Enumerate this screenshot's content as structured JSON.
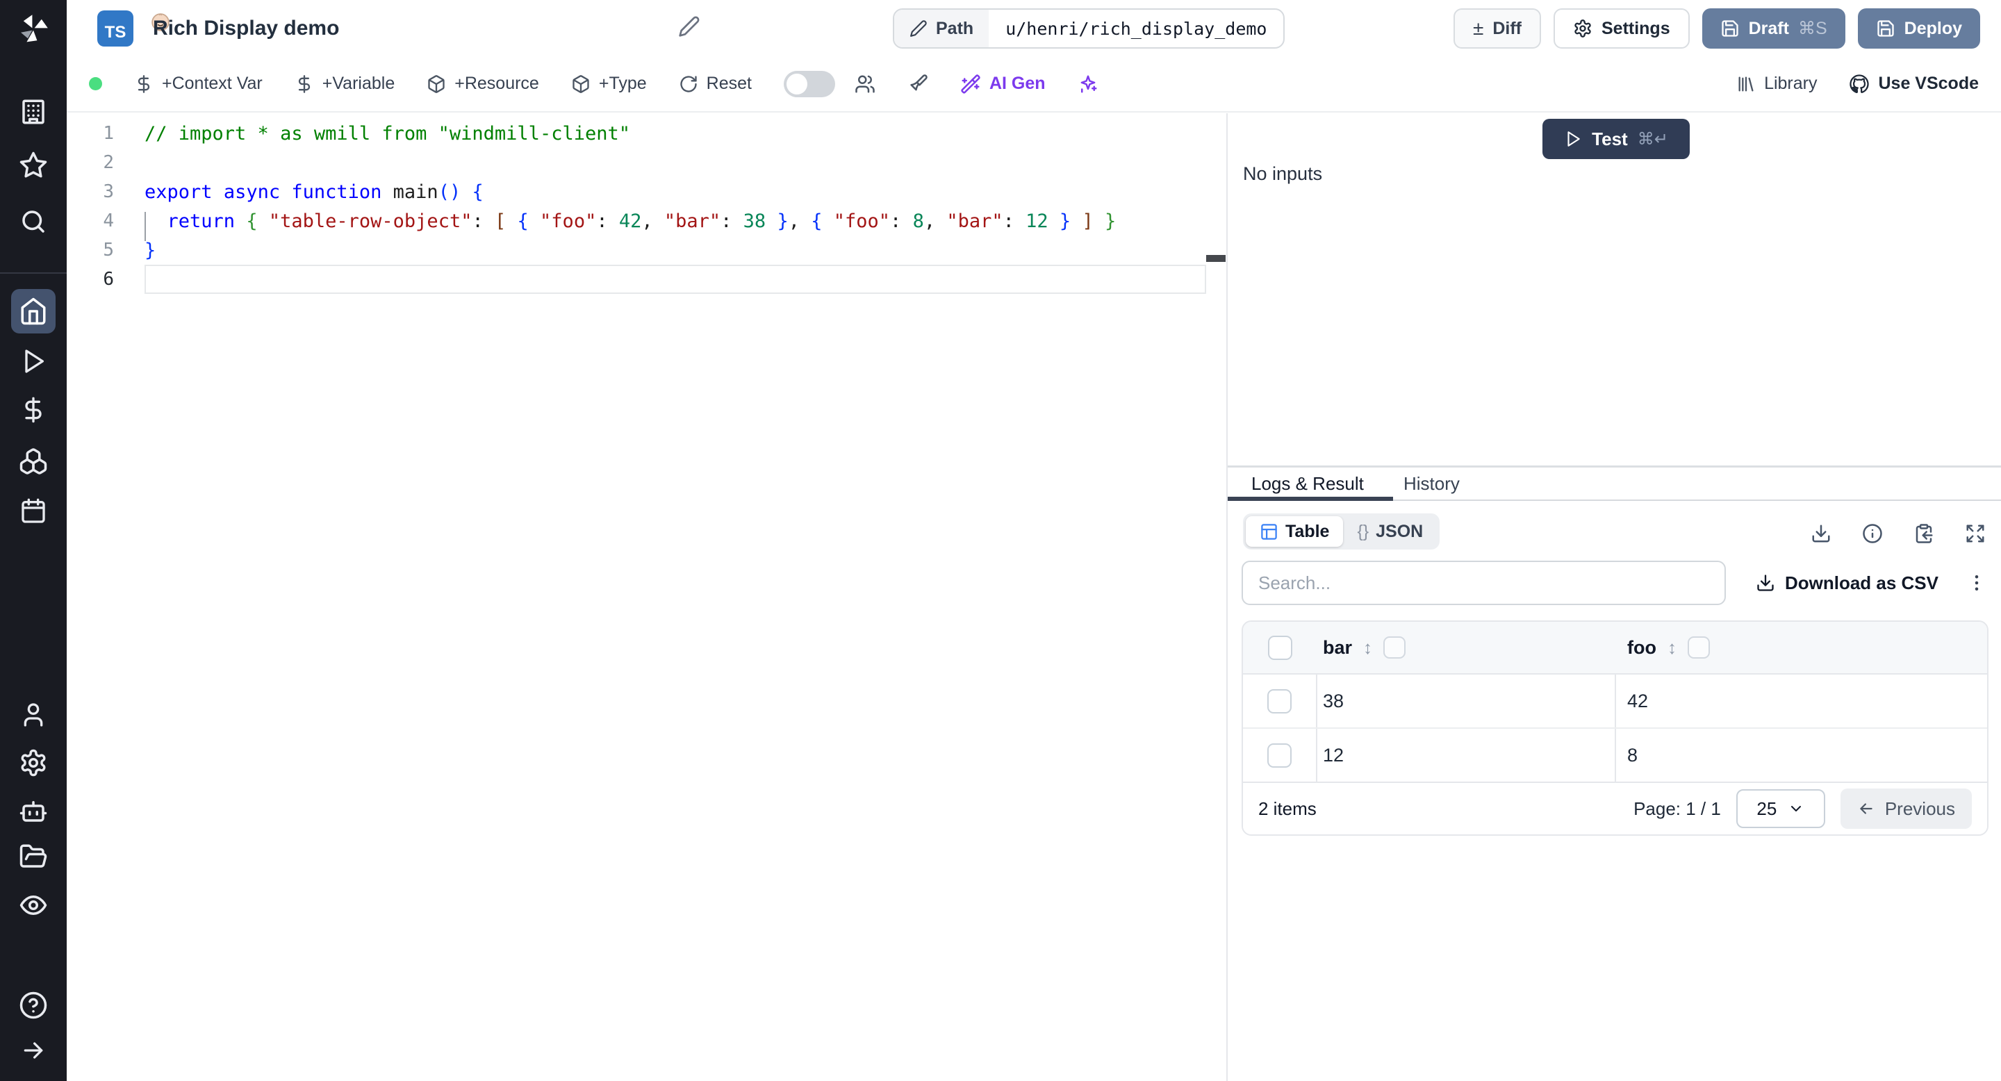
{
  "colors": {
    "sidebar_bg": "#191b22",
    "sidebar_active_bg": "#44536e",
    "primary_button": "#667d9e",
    "test_button": "#303c55",
    "accent_blue": "#3b82f6",
    "ts_badge": "#3178c6",
    "ai_purple": "#7c3aed",
    "status_green": "#4ade80",
    "border": "#e5e7eb"
  },
  "sidebar": {
    "icons": [
      "windmill-logo",
      "workspace-building",
      "favorites-star",
      "search",
      "home",
      "runs-play",
      "variables-dollar",
      "resources-boxes",
      "schedules-calendar",
      "user",
      "settings-gear",
      "workers-bot",
      "folders",
      "audit-eye",
      "help",
      "expand-arrow"
    ]
  },
  "header": {
    "badge": "TS",
    "title": "Rich Display demo",
    "path_label": "Path",
    "path_value": "u/henri/rich_display_demo",
    "diff_glyph": "±",
    "diff": "Diff",
    "settings": "Settings",
    "draft": "Draft",
    "draft_shortcut": "⌘S",
    "deploy": "Deploy"
  },
  "toolbar": {
    "context_var": "+Context Var",
    "variable": "+Variable",
    "resource": "+Resource",
    "type": "+Type",
    "reset": "Reset",
    "ai_gen": "AI Gen",
    "library": "Library",
    "use_vscode": "Use VScode"
  },
  "editor": {
    "token_colors": {
      "comment": "#008000",
      "keyword": "#0000ff",
      "string": "#a31515",
      "number": "#098658",
      "ident": "#1e1e1e",
      "plain": "#1e1e1e",
      "b1": "#0431fa",
      "b2": "#319331",
      "b3": "#7b3814"
    },
    "lines": [
      {
        "n": "1",
        "tokens": [
          [
            "comment",
            "// import * as wmill from \"windmill-client\""
          ]
        ]
      },
      {
        "n": "2",
        "tokens": []
      },
      {
        "n": "3",
        "tokens": [
          [
            "keyword",
            "export"
          ],
          [
            "plain",
            " "
          ],
          [
            "keyword",
            "async"
          ],
          [
            "plain",
            " "
          ],
          [
            "keyword",
            "function"
          ],
          [
            "ident",
            " main"
          ],
          [
            "b1",
            "()"
          ],
          [
            "plain",
            " "
          ],
          [
            "b1",
            "{"
          ]
        ]
      },
      {
        "n": "4",
        "tokens": [
          [
            "plain",
            "  "
          ],
          [
            "keyword",
            "return"
          ],
          [
            "plain",
            " "
          ],
          [
            "b2",
            "{"
          ],
          [
            "plain",
            " "
          ],
          [
            "string",
            "\"table-row-object\""
          ],
          [
            "plain",
            ": "
          ],
          [
            "b3",
            "["
          ],
          [
            "plain",
            " "
          ],
          [
            "b1",
            "{"
          ],
          [
            "plain",
            " "
          ],
          [
            "string",
            "\"foo\""
          ],
          [
            "plain",
            ": "
          ],
          [
            "number",
            "42"
          ],
          [
            "plain",
            ", "
          ],
          [
            "string",
            "\"bar\""
          ],
          [
            "plain",
            ": "
          ],
          [
            "number",
            "38"
          ],
          [
            "plain",
            " "
          ],
          [
            "b1",
            "}"
          ],
          [
            "plain",
            ", "
          ],
          [
            "b1",
            "{"
          ],
          [
            "plain",
            " "
          ],
          [
            "string",
            "\"foo\""
          ],
          [
            "plain",
            ": "
          ],
          [
            "number",
            "8"
          ],
          [
            "plain",
            ", "
          ],
          [
            "string",
            "\"bar\""
          ],
          [
            "plain",
            ": "
          ],
          [
            "number",
            "12"
          ],
          [
            "plain",
            " "
          ],
          [
            "b1",
            "}"
          ],
          [
            "plain",
            " "
          ],
          [
            "b3",
            "]"
          ],
          [
            "plain",
            " "
          ],
          [
            "b2",
            "}"
          ]
        ]
      },
      {
        "n": "5",
        "tokens": [
          [
            "b1",
            "}"
          ]
        ]
      },
      {
        "n": "6",
        "tokens": [],
        "current": true
      }
    ]
  },
  "run_panel": {
    "test": "Test",
    "test_shortcut": "⌘↵",
    "no_inputs": "No inputs"
  },
  "result_panel": {
    "tabs": {
      "logs": "Logs & Result",
      "history": "History"
    },
    "view_toggle": {
      "table": "Table",
      "json_glyph": "{}",
      "json": "JSON"
    },
    "search_placeholder": "Search...",
    "download_csv": "Download as CSV",
    "table": {
      "columns": [
        "bar",
        "foo"
      ],
      "sort_glyph": "↕",
      "rows": [
        [
          "38",
          "42"
        ],
        [
          "12",
          "8"
        ]
      ]
    },
    "footer": {
      "items": "2 items",
      "page": "Page: 1 / 1",
      "page_size": "25",
      "prev_arrow": "←",
      "previous": "Previous"
    }
  }
}
